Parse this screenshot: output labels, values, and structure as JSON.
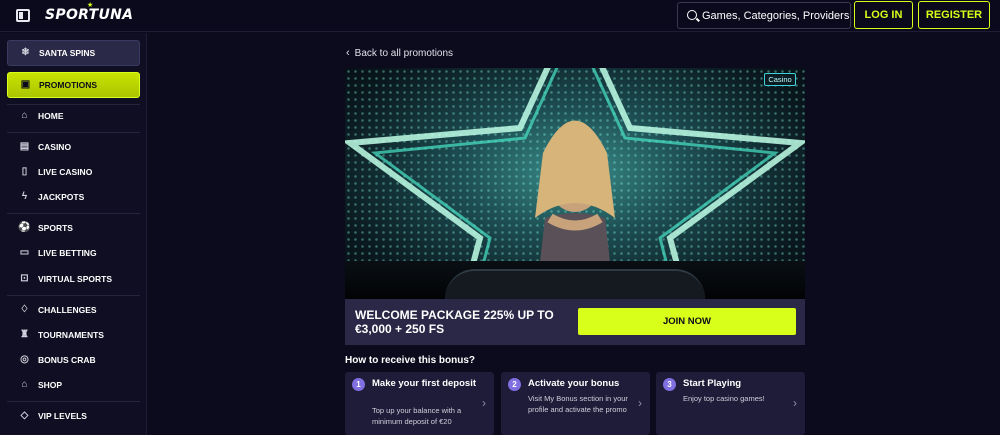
{
  "header": {
    "logo": "SPORTUNA",
    "search_placeholder": "Games, Categories, Providers",
    "login_label": "LOG IN",
    "register_label": "REGISTER"
  },
  "sidebar": {
    "items": [
      {
        "label": "SANTA SPINS",
        "icon": "snowflake-icon"
      },
      {
        "label": "PROMOTIONS",
        "icon": "gift-icon"
      },
      {
        "label": "HOME",
        "icon": "home-icon"
      },
      {
        "label": "CASINO",
        "icon": "slot-machine-icon"
      },
      {
        "label": "LIVE CASINO",
        "icon": "card-icon"
      },
      {
        "label": "JACKPOTS",
        "icon": "lightning-icon"
      },
      {
        "label": "SPORTS",
        "icon": "ball-icon"
      },
      {
        "label": "LIVE BETTING",
        "icon": "ticket-icon"
      },
      {
        "label": "VIRTUAL SPORTS",
        "icon": "gamepad-icon"
      },
      {
        "label": "CHALLENGES",
        "icon": "medal-icon"
      },
      {
        "label": "TOURNAMENTS",
        "icon": "trophy-icon"
      },
      {
        "label": "BONUS CRAB",
        "icon": "crab-icon"
      },
      {
        "label": "SHOP",
        "icon": "shop-icon"
      },
      {
        "label": "VIP LEVELS",
        "icon": "diamond-icon"
      }
    ]
  },
  "promo": {
    "back_label": "Back to all promotions",
    "badge": "Casino",
    "title": "WELCOME PACKAGE 225% UP TO €3,000 + 250 FS",
    "join_label": "JOIN NOW",
    "how_title": "How to receive this bonus?",
    "steps": [
      {
        "num": "1",
        "title": "Make your first deposit",
        "desc": "Top up your balance with a minimum deposit of €20"
      },
      {
        "num": "2",
        "title": "Activate your bonus",
        "desc": "Visit My Bonus section in your profile and activate the promo"
      },
      {
        "num": "3",
        "title": "Start Playing",
        "desc": "Enjoy top casino games!"
      }
    ]
  },
  "colors": {
    "accent": "#d8ff1a",
    "background": "#0c0b1d",
    "sidebar": "#0f0e22",
    "step_number": "#7f6fe0"
  }
}
